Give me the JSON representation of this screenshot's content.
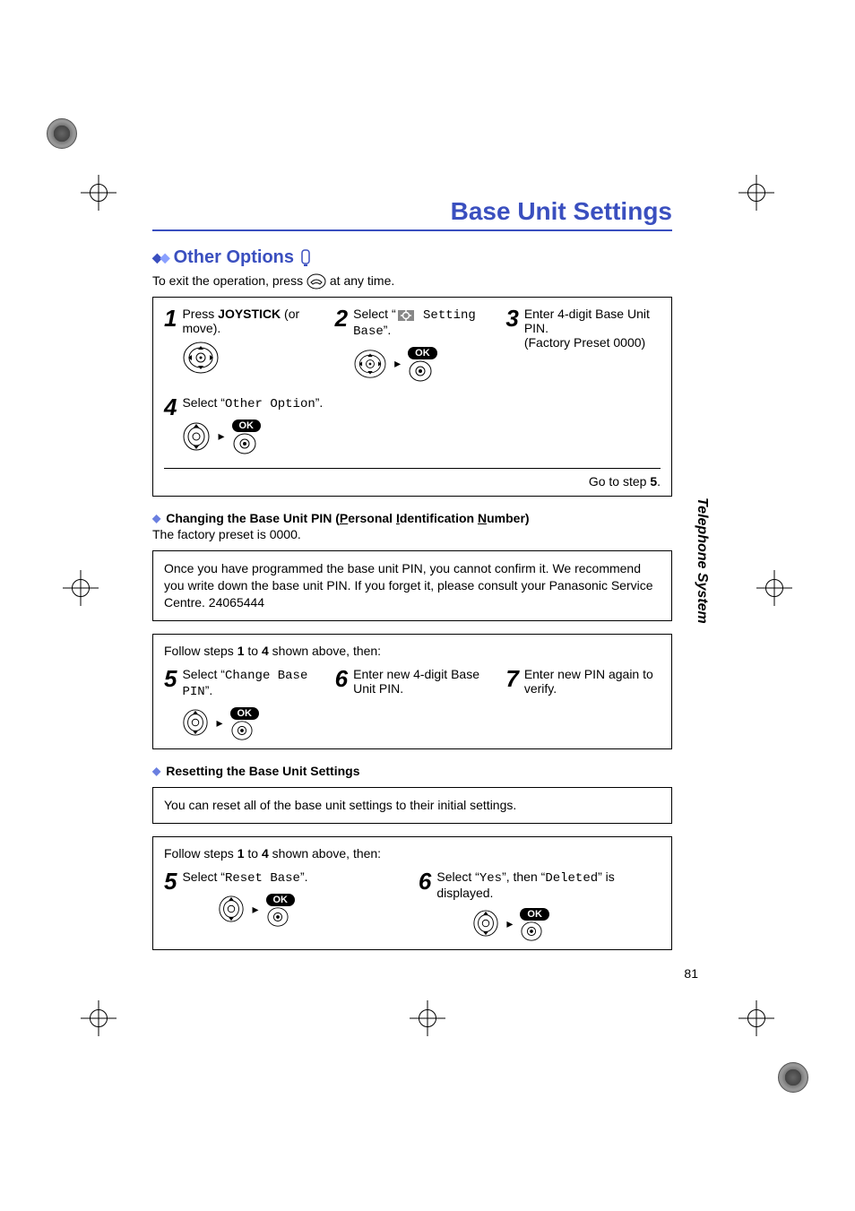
{
  "page": {
    "title": "Base Unit Settings",
    "number": "81",
    "side_tab": "Telephone System"
  },
  "section": {
    "header": "Other Options",
    "exit_line_prefix": "To exit the operation, press ",
    "exit_line_suffix": " at any time."
  },
  "steps_main": {
    "s1": {
      "num": "1",
      "text_prefix": "Press ",
      "text_bold": "JOYSTICK",
      "text_suffix": " (or move)."
    },
    "s2": {
      "num": "2",
      "text_prefix": "Select “",
      "mono1": " Setting Base",
      "text_suffix": "”.",
      "ok": "OK"
    },
    "s3": {
      "num": "3",
      "line1": "Enter 4-digit Base Unit PIN.",
      "line2": "(Factory Preset 0000)"
    },
    "s4": {
      "num": "4",
      "text_prefix": "Select “",
      "mono": "Other Option",
      "text_suffix": "”.",
      "ok": "OK"
    },
    "goto_prefix": "Go to step ",
    "goto_bold": "5",
    "goto_suffix": "."
  },
  "changing_pin": {
    "heading_prefix": "Changing the Base Unit PIN (",
    "heading_p": "P",
    "heading_mid1": "ersonal ",
    "heading_i": "I",
    "heading_mid2": "dentification ",
    "heading_n": "N",
    "heading_suffix": "umber)",
    "preset_line": "The factory preset is 0000.",
    "warn": "Once you have programmed the base unit PIN, you cannot confirm it. We recommend you write down the base unit PIN. If you forget it, please consult your Panasonic Service Centre. 24065444",
    "follow_prefix": "Follow steps ",
    "follow_b1": "1",
    "follow_mid": " to ",
    "follow_b2": "4",
    "follow_suffix": " shown above, then:",
    "s5": {
      "num": "5",
      "text_prefix": "Select “",
      "mono": "Change Base PIN",
      "text_suffix": "”.",
      "ok": "OK"
    },
    "s6": {
      "num": "6",
      "text": "Enter new 4-digit Base Unit PIN."
    },
    "s7": {
      "num": "7",
      "text": "Enter new PIN again to verify."
    }
  },
  "resetting": {
    "heading": "Resetting the Base Unit Settings",
    "info": "You can reset all of the base unit settings to their initial settings.",
    "follow_prefix": "Follow steps ",
    "follow_b1": "1",
    "follow_mid": " to ",
    "follow_b2": "4",
    "follow_suffix": " shown above, then:",
    "s5": {
      "num": "5",
      "text_prefix": "Select “",
      "mono": "Reset Base",
      "text_suffix": "”.",
      "ok": "OK"
    },
    "s6": {
      "num": "6",
      "text_prefix": "Select “",
      "mono1": "Yes",
      "text_mid": "”, then “",
      "mono2": "Deleted",
      "text_suffix": "” is displayed.",
      "ok": "OK"
    }
  }
}
